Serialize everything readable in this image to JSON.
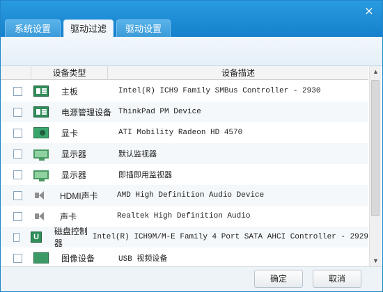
{
  "window": {
    "close_glyph": "×"
  },
  "tabs": [
    {
      "label": "系统设置",
      "active": false
    },
    {
      "label": "驱动过滤",
      "active": true
    },
    {
      "label": "驱动设置",
      "active": false
    }
  ],
  "table": {
    "headers": [
      "设备类型",
      "设备描述"
    ],
    "rows": [
      {
        "icon": "motherboard-icon",
        "type": "主板",
        "desc": "Intel(R) ICH9 Family SMBus Controller - 2930"
      },
      {
        "icon": "power-management-icon",
        "type": "电源管理设备",
        "desc": "ThinkPad PM Device"
      },
      {
        "icon": "graphics-card-icon",
        "type": "显卡",
        "desc": "ATI Mobility Radeon HD 4570"
      },
      {
        "icon": "monitor-icon",
        "type": "显示器",
        "desc": "默认监视器"
      },
      {
        "icon": "monitor-icon",
        "type": "显示器",
        "desc": "即插即用监视器"
      },
      {
        "icon": "speaker-icon",
        "type": "HDMI声卡",
        "desc": "AMD High Definition Audio Device"
      },
      {
        "icon": "speaker-icon",
        "type": "声卡",
        "desc": "Realtek High Definition Audio"
      },
      {
        "icon": "usb-icon",
        "type": "磁盘控制器",
        "desc": "Intel(R) ICH9M/M-E Family 4 Port SATA AHCI Controller - 2929"
      },
      {
        "icon": "camera-icon",
        "type": "图像设备",
        "desc": "USB 视频设备"
      }
    ]
  },
  "footer": {
    "ok_label": "确定",
    "cancel_label": "取消"
  },
  "colors": {
    "titlebar": "#1f86c8",
    "accent_green": "#2e8b57"
  }
}
